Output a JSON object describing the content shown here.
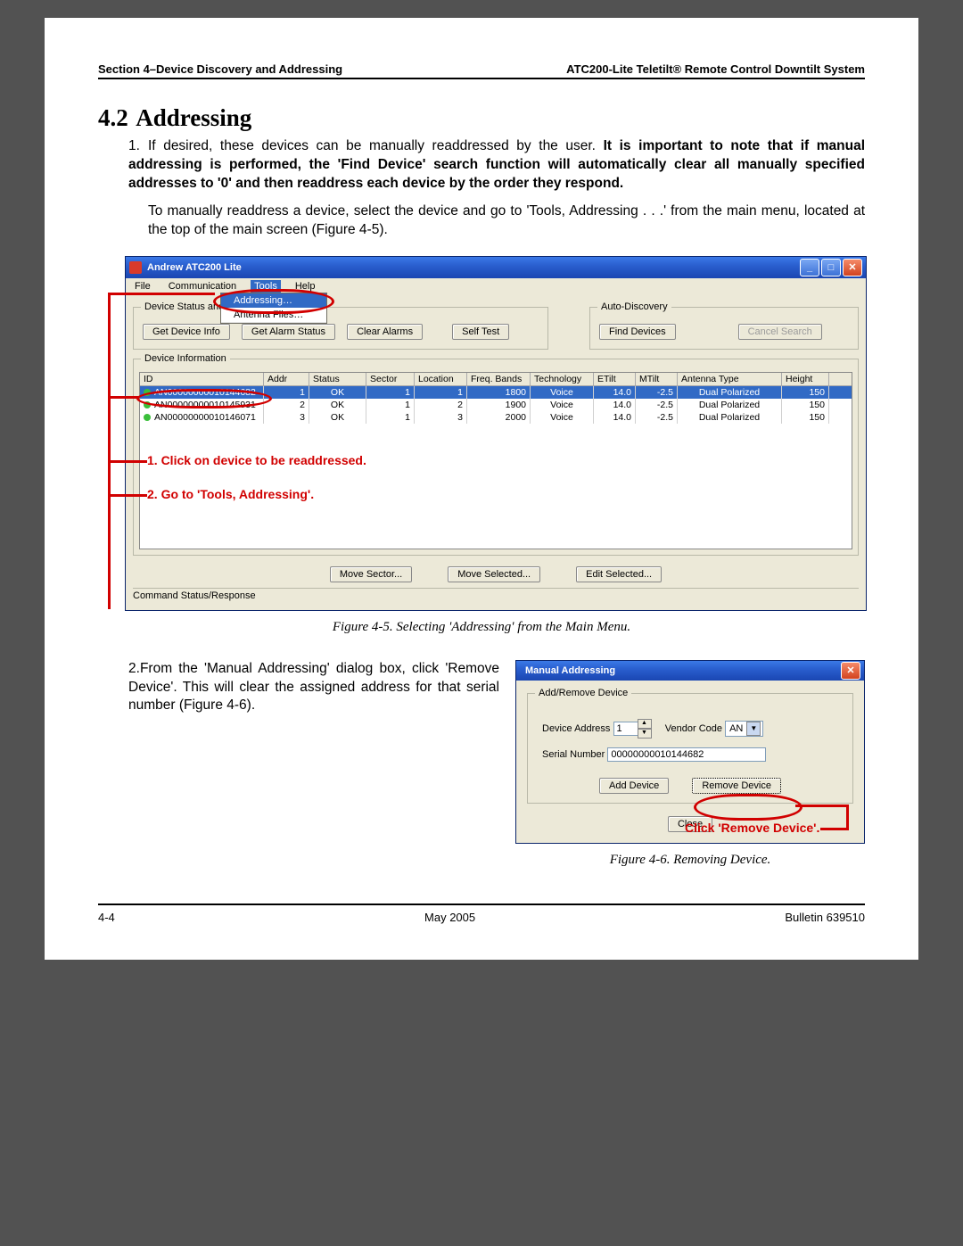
{
  "header": {
    "left": "Section 4–Device Discovery and Addressing",
    "right": "ATC200-Lite Teletilt® Remote Control Downtilt System"
  },
  "section": {
    "number": "4.2",
    "title": "Addressing"
  },
  "para1": {
    "num": "1.",
    "lead": "If desired, these devices can be manually readdressed by the user. ",
    "bold": "It is important to note that if manual addressing is performed, the 'Find Device' search function will automatically clear all manually specified addresses to '0' and then readdress each device by the order they respond.",
    "tail": "To manually readdress a device, select the device and go to 'Tools, Addressing . . .' from the main menu, located at the top of the main screen (Figure 4-5)."
  },
  "fig45": {
    "title": "Andrew ATC200 Lite",
    "menu": {
      "file": "File",
      "comm": "Communication",
      "tools": "Tools",
      "help": "Help"
    },
    "dropdown": {
      "addressing": "Addressing…",
      "antenna": "Antenna Files…"
    },
    "grp_status": "Device Status and Alarms",
    "grp_auto": "Auto-Discovery",
    "btn_getinfo": "Get Device Info",
    "btn_getalarm": "Get Alarm Status",
    "btn_clear": "Clear Alarms",
    "btn_self": "Self Test",
    "btn_find": "Find Devices",
    "btn_cancel": "Cancel Search",
    "grp_devinfo": "Device Information",
    "cols": {
      "id": "ID",
      "addr": "Addr",
      "status": "Status",
      "sector": "Sector",
      "loc": "Location",
      "freq": "Freq. Bands",
      "tech": "Technology",
      "etilt": "ETilt",
      "mtilt": "MTilt",
      "ant": "Antenna Type",
      "h": "Height"
    },
    "rows": [
      {
        "id": "AN00000000010144682",
        "addr": "1",
        "status": "OK",
        "sector": "1",
        "loc": "1",
        "freq": "1800",
        "tech": "Voice",
        "etilt": "14.0",
        "mtilt": "-2.5",
        "ant": "Dual Polarized",
        "h": "150"
      },
      {
        "id": "AN00000000010145931",
        "addr": "2",
        "status": "OK",
        "sector": "1",
        "loc": "2",
        "freq": "1900",
        "tech": "Voice",
        "etilt": "14.0",
        "mtilt": "-2.5",
        "ant": "Dual Polarized",
        "h": "150"
      },
      {
        "id": "AN00000000010146071",
        "addr": "3",
        "status": "OK",
        "sector": "1",
        "loc": "3",
        "freq": "2000",
        "tech": "Voice",
        "etilt": "14.0",
        "mtilt": "-2.5",
        "ant": "Dual Polarized",
        "h": "150"
      }
    ],
    "btn_movesector": "Move Sector...",
    "btn_movesel": "Move Selected...",
    "btn_editsel": "Edit Selected...",
    "cmdstatus": "Command Status/Response",
    "anno1": "1. Click on device to be readdressed.",
    "anno2": "2. Go to 'Tools, Addressing'.",
    "caption": "Figure 4-5. Selecting 'Addressing' from the Main Menu."
  },
  "para2": {
    "num": "2.",
    "text": "From the 'Manual Addressing' dialog box, click 'Remove Device'. This will clear the assigned address for that serial number (Figure 4-6)."
  },
  "fig46": {
    "title": "Manual Addressing",
    "grp": "Add/Remove Device",
    "lbl_addr": "Device Address",
    "val_addr": "1",
    "lbl_vendor": "Vendor Code",
    "val_vendor": "AN",
    "lbl_serial": "Serial Number",
    "val_serial": "00000000010144682",
    "btn_add": "Add Device",
    "btn_remove": "Remove Device",
    "btn_close": "Close",
    "anno": "Click 'Remove Device'.",
    "caption": "Figure 4-6. Removing Device."
  },
  "footer": {
    "left": "4-4",
    "center": "May 2005",
    "right": "Bulletin 639510"
  }
}
